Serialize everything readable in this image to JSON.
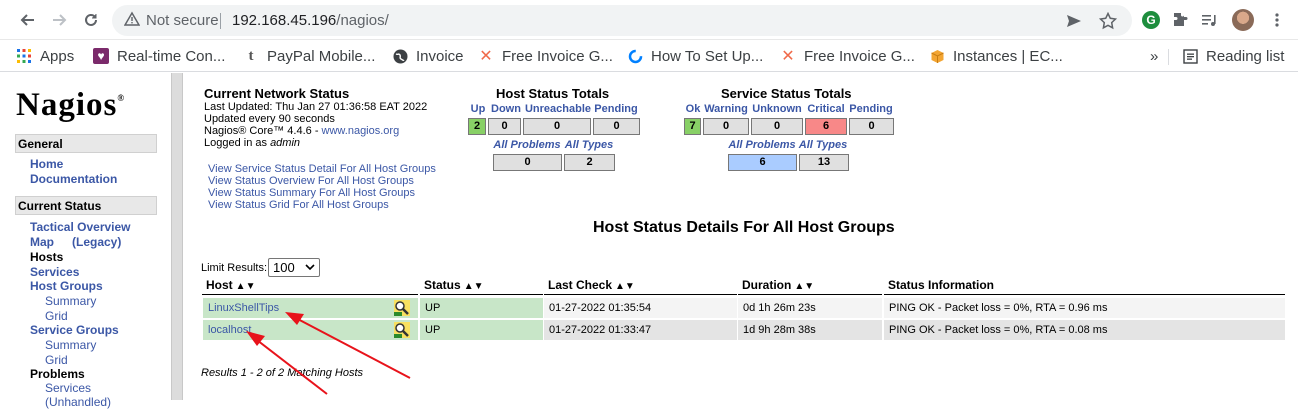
{
  "browser": {
    "security_label": "Not secure",
    "url_host": "192.168.45.196",
    "url_path": "/nagios/",
    "bookmarks": [
      {
        "label": "Apps",
        "icon": "apps-grid-icon"
      },
      {
        "label": "Real-time Con...",
        "icon": "bookmark-favicon"
      },
      {
        "label": "PayPal Mobile...",
        "icon": "bookmark-favicon"
      },
      {
        "label": "Invoice",
        "icon": "bookmark-favicon"
      },
      {
        "label": "Free Invoice G...",
        "icon": "bookmark-favicon"
      },
      {
        "label": "How To Set Up...",
        "icon": "bookmark-favicon"
      },
      {
        "label": "Free Invoice G...",
        "icon": "bookmark-favicon"
      },
      {
        "label": "Instances | EC...",
        "icon": "bookmark-favicon"
      }
    ],
    "more_bookmarks": "»",
    "reading_list": "Reading list",
    "profile_letter": "G"
  },
  "sidebar": {
    "logo": "Nagios",
    "logo_mark": "®",
    "general": {
      "title": "General",
      "links": [
        "Home",
        "Documentation"
      ]
    },
    "current_status": {
      "title": "Current Status",
      "tactical": "Tactical Overview",
      "map": "Map",
      "map_legacy": "(Legacy)",
      "hosts": "Hosts",
      "services": "Services",
      "host_groups": "Host Groups",
      "hg_summary": "Summary",
      "hg_grid": "Grid",
      "service_groups": "Service Groups",
      "sg_summary": "Summary",
      "sg_grid": "Grid",
      "problems": "Problems",
      "pr_services": "Services",
      "pr_unhandled": "(Unhandled)"
    }
  },
  "network_status": {
    "title": "Current Network Status",
    "last_updated": "Last Updated: Thu Jan 27 01:36:58 EAT 2022",
    "update_interval": "Updated every 90 seconds",
    "core_prefix": "Nagios® Core™ 4.4.6 - ",
    "core_link": "www.nagios.org",
    "logged_in_prefix": "Logged in as ",
    "user": "admin",
    "links": [
      "View Service Status Detail For All Host Groups",
      "View Status Overview For All Host Groups",
      "View Status Summary For All Host Groups",
      "View Status Grid For All Host Groups"
    ]
  },
  "host_totals": {
    "title": "Host Status Totals",
    "headers": [
      "Up",
      "Down",
      "Unreachable",
      "Pending"
    ],
    "values": [
      "2",
      "0",
      "0",
      "0"
    ],
    "problem_headers": [
      "All Problems",
      "All Types"
    ],
    "problem_values": [
      "0",
      "2"
    ]
  },
  "service_totals": {
    "title": "Service Status Totals",
    "headers": [
      "Ok",
      "Warning",
      "Unknown",
      "Critical",
      "Pending"
    ],
    "values": [
      "7",
      "0",
      "0",
      "6",
      "0"
    ],
    "problem_headers": [
      "All Problems",
      "All Types"
    ],
    "problem_values": [
      "6",
      "13"
    ]
  },
  "details": {
    "title": "Host Status Details For All Host Groups",
    "limit_label": "Limit Results:",
    "limit_value": "100",
    "columns": [
      "Host",
      "Status",
      "Last Check",
      "Duration",
      "Status Information"
    ],
    "rows": [
      {
        "host": "LinuxShellTips",
        "status": "UP",
        "last_check": "01-27-2022 01:35:54",
        "duration": "0d 1h 26m 23s",
        "info": "PING OK - Packet loss = 0%, RTA = 0.96 ms"
      },
      {
        "host": "localhost",
        "status": "UP",
        "last_check": "01-27-2022 01:33:47",
        "duration": "1d 9h 28m 38s",
        "info": "PING OK - Packet loss = 0%, RTA = 0.08 ms"
      }
    ],
    "results": "Results 1 - 2 of 2 Matching Hosts"
  },
  "colors": {
    "link": "#3b57a6",
    "up_bg": "#c8e6c8",
    "ok_green": "#88d066",
    "critical_red": "#f88888",
    "problems_blue": "#aaccff",
    "annotation_arrow": "#e8131b"
  }
}
